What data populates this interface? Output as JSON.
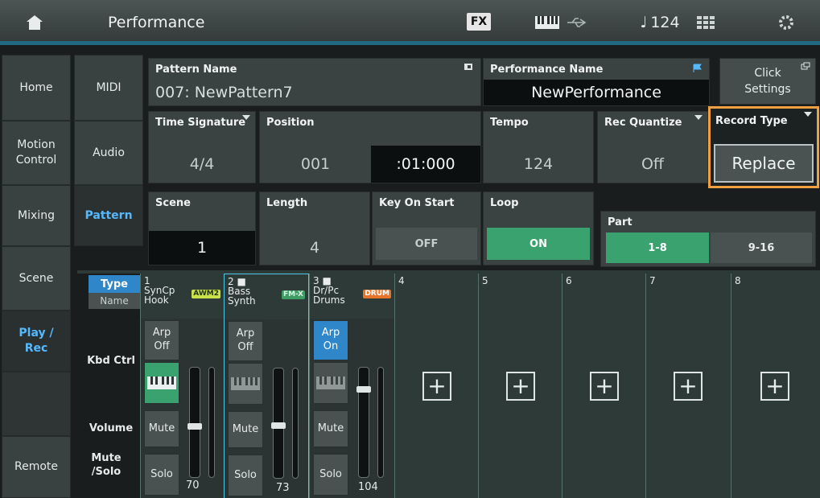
{
  "topbar": {
    "title": "Performance",
    "fx": "FX",
    "tempo": "124",
    "tempo_note": "♩"
  },
  "nav": [
    "Home",
    "Motion Control",
    "Mixing",
    "Scene",
    "Play / Rec",
    "Remote"
  ],
  "subnav": [
    "MIDI",
    "Audio",
    "Pattern"
  ],
  "pattern": {
    "label": "Pattern Name",
    "value": "007: NewPattern7"
  },
  "performance": {
    "label": "Performance Name",
    "value": "NewPerformance"
  },
  "click": {
    "label": "Click Settings"
  },
  "time_signature": {
    "label": "Time Signature",
    "value": "4/4"
  },
  "position": {
    "label": "Position",
    "measure": "001",
    "beat": ":01:000"
  },
  "tempo": {
    "label": "Tempo",
    "value": "124"
  },
  "rec_quantize": {
    "label": "Rec Quantize",
    "value": "Off"
  },
  "record_type": {
    "label": "Record Type",
    "value": "Replace"
  },
  "scene": {
    "label": "Scene",
    "value": "1"
  },
  "length": {
    "label": "Length",
    "value": "4"
  },
  "key_on_start": {
    "label": "Key On Start",
    "value": "OFF"
  },
  "loop": {
    "label": "Loop",
    "value": "ON"
  },
  "part": {
    "label": "Part",
    "tab1": "1-8",
    "tab2": "9-16"
  },
  "type_name": {
    "type": "Type",
    "name": "Name"
  },
  "rows": {
    "kbd": "Kbd Ctrl",
    "volume": "Volume",
    "mute_solo": "Mute /Solo"
  },
  "parts": [
    {
      "num": "1",
      "name1": "SynCp",
      "name2": "Hook",
      "badge": "AWM2",
      "arp": "Arp Off",
      "volume": "70",
      "volume_level": 0.46
    },
    {
      "num": "2 ■",
      "name1": "Bass",
      "name2": "Synth",
      "badge": "FM-X",
      "arp": "Arp Off",
      "volume": "73",
      "volume_level": 0.48
    },
    {
      "num": "3 ■",
      "name1": "Dr/Pc",
      "name2": "Drums",
      "badge": "DRUM",
      "arp": "Arp On",
      "volume": "104",
      "volume_level": 0.82
    },
    {
      "num": "4"
    },
    {
      "num": "5"
    },
    {
      "num": "6"
    },
    {
      "num": "7"
    },
    {
      "num": "8"
    }
  ],
  "mute": "Mute",
  "solo": "Solo",
  "colors": {
    "accent_blue": "#56b9ff",
    "on_green": "#3aa26e",
    "highlight_orange": "#f0a040",
    "selected_cyan": "#4fc8e8"
  }
}
